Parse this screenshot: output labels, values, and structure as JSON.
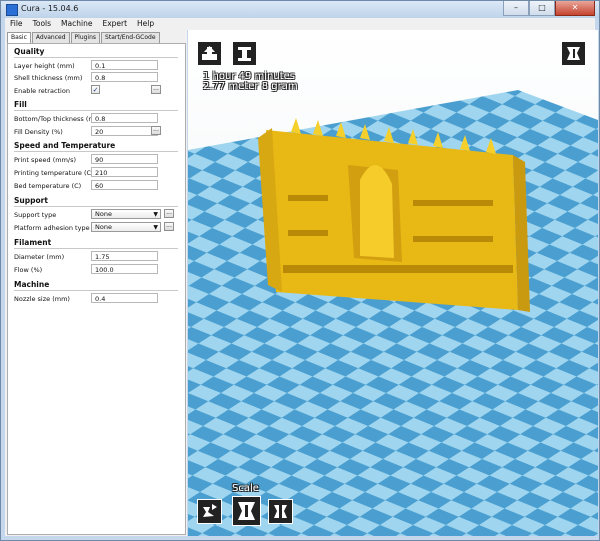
{
  "window": {
    "title": "Cura - 15.04.6",
    "min_label": "–",
    "max_label": "□",
    "close_label": "✕"
  },
  "menu": [
    "File",
    "Tools",
    "Machine",
    "Expert",
    "Help"
  ],
  "tabs": [
    "Basic",
    "Advanced",
    "Plugins",
    "Start/End-GCode"
  ],
  "quality": {
    "heading": "Quality",
    "layer_height_label": "Layer height (mm)",
    "layer_height": "0.1",
    "shell_thickness_label": "Shell thickness (mm)",
    "shell_thickness": "0.8",
    "retraction_label": "Enable retraction",
    "retraction_checked": true
  },
  "fill": {
    "heading": "Fill",
    "bottom_top_label": "Bottom/Top thickness (mm)",
    "bottom_top": "0.8",
    "density_label": "Fill Density (%)",
    "density": "20"
  },
  "speed": {
    "heading": "Speed and Temperature",
    "print_speed_label": "Print speed (mm/s)",
    "print_speed": "90",
    "printing_temp_label": "Printing temperature (C)",
    "printing_temp": "210",
    "bed_temp_label": "Bed temperature (C)",
    "bed_temp": "60"
  },
  "support": {
    "heading": "Support",
    "support_type_label": "Support type",
    "support_type": "None",
    "adhesion_label": "Platform adhesion type",
    "adhesion": "None"
  },
  "filament": {
    "heading": "Filament",
    "diameter_label": "Diameter (mm)",
    "diameter": "1.75",
    "flow_label": "Flow (%)",
    "flow": "100.0"
  },
  "machine": {
    "heading": "Machine",
    "nozzle_label": "Nozzle size (mm)",
    "nozzle": "0.4"
  },
  "viewer": {
    "print_time": "1 hour 49 minutes",
    "material": "2.77 meter 8 gram",
    "scale_label": "Scale"
  },
  "colors": {
    "model": "#f2c21a",
    "floor_light": "#9fd5ef",
    "floor_dark": "#4a9fd0"
  }
}
